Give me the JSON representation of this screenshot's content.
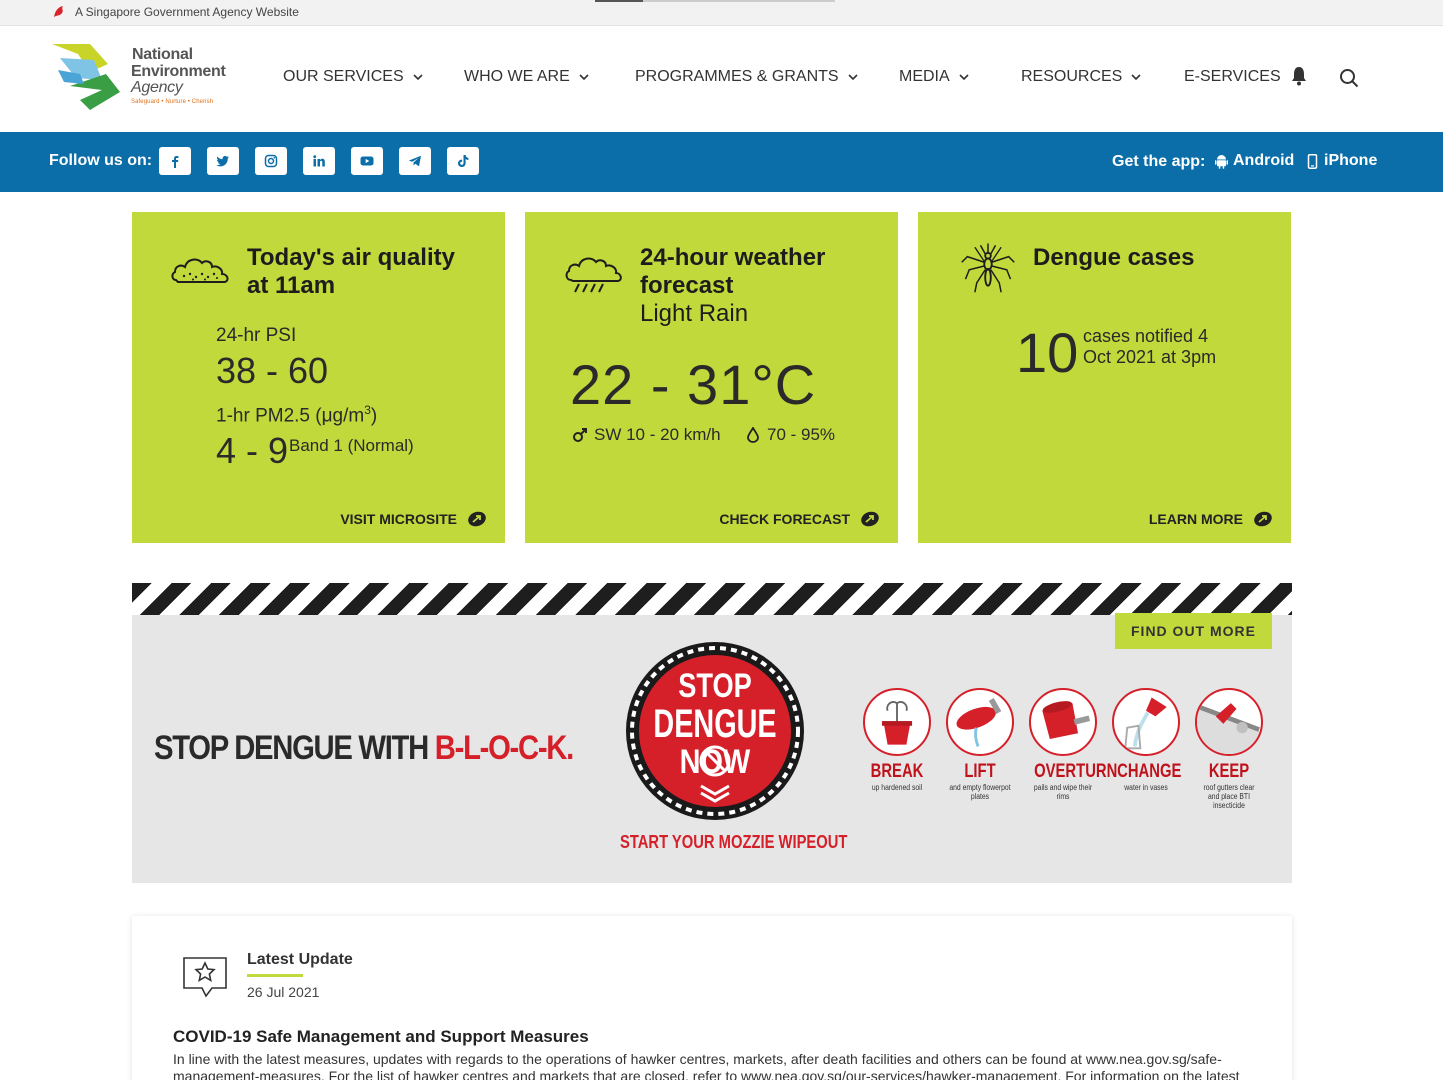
{
  "govbar": {
    "text": "A Singapore Government Agency Website"
  },
  "logo": {
    "line1": "National",
    "line2": "Environment",
    "line3": "Agency",
    "tagline": "Safeguard • Nurture • Cherish"
  },
  "nav": {
    "items": [
      {
        "label": "OUR SERVICES"
      },
      {
        "label": "WHO WE ARE"
      },
      {
        "label": "PROGRAMMES & GRANTS"
      },
      {
        "label": "MEDIA"
      },
      {
        "label": "RESOURCES"
      },
      {
        "label": "E-SERVICES"
      }
    ],
    "notification_icon": "bell-icon",
    "search_icon": "search-icon"
  },
  "social": {
    "follow_label": "Follow us on:",
    "icons": [
      "facebook-icon",
      "twitter-icon",
      "instagram-icon",
      "linkedin-icon",
      "youtube-icon",
      "telegram-icon",
      "tiktok-icon"
    ],
    "get_app_label": "Get the app:",
    "android_label": "Android",
    "iphone_label": "iPhone"
  },
  "cards": {
    "air": {
      "title": "Today's air quality",
      "title2": "at 11am",
      "psi_label": "24-hr PSI",
      "psi_value": "38 - 60",
      "pm_label": "1-hr PM2.5 (μg/m",
      "pm_sup": "3",
      "pm_close": ")",
      "pm_value": "4 - 9",
      "pm_band": "Band 1 (Normal)",
      "link": "VISIT MICROSITE"
    },
    "weather": {
      "title": "24-hour weather",
      "title2": "forecast",
      "condition": "Light Rain",
      "temp": "22 - 31°C",
      "wind": "SW 10 - 20 km/h",
      "humidity": "70 - 95%",
      "link": "CHECK FORECAST"
    },
    "dengue": {
      "title": "Dengue cases",
      "count": "10",
      "text": "cases notified 4 Oct 2021 at 3pm",
      "link": "LEARN MORE"
    }
  },
  "banner": {
    "find_more": "FIND OUT MORE",
    "headline_a": "STOP DENGUE WITH ",
    "headline_b": "B-L-O-C-K.",
    "badge_line1": "STOP",
    "badge_line2": "DENGUE",
    "badge_line3": "NOW",
    "wipeout": "START YOUR MOZZIE WIPEOUT",
    "steps": [
      {
        "word": "BREAK",
        "desc": "up hardened soil"
      },
      {
        "word": "LIFT",
        "desc": "and empty flowerpot plates"
      },
      {
        "word": "OVERTURN",
        "desc": "pails and wipe their rims"
      },
      {
        "word": "CHANGE",
        "desc": "water in vases"
      },
      {
        "word": "KEEP",
        "desc": "roof gutters clear and place BTI insecticide"
      }
    ],
    "colors": {
      "red": "#d5202a",
      "green": "#c1d93b"
    }
  },
  "update": {
    "label": "Latest Update",
    "date": "26 Jul 2021",
    "headline": "COVID-19 Safe Management and Support Measures",
    "body": "In line with the latest measures, updates with regards to the operations of hawker centres, markets, after death facilities and others can be found at www.nea.gov.sg/safe-management-measures. For the list of hawker centres and markets that are closed, refer to www.nea.gov.sg/our-services/hawker-management. For information on the latest"
  }
}
